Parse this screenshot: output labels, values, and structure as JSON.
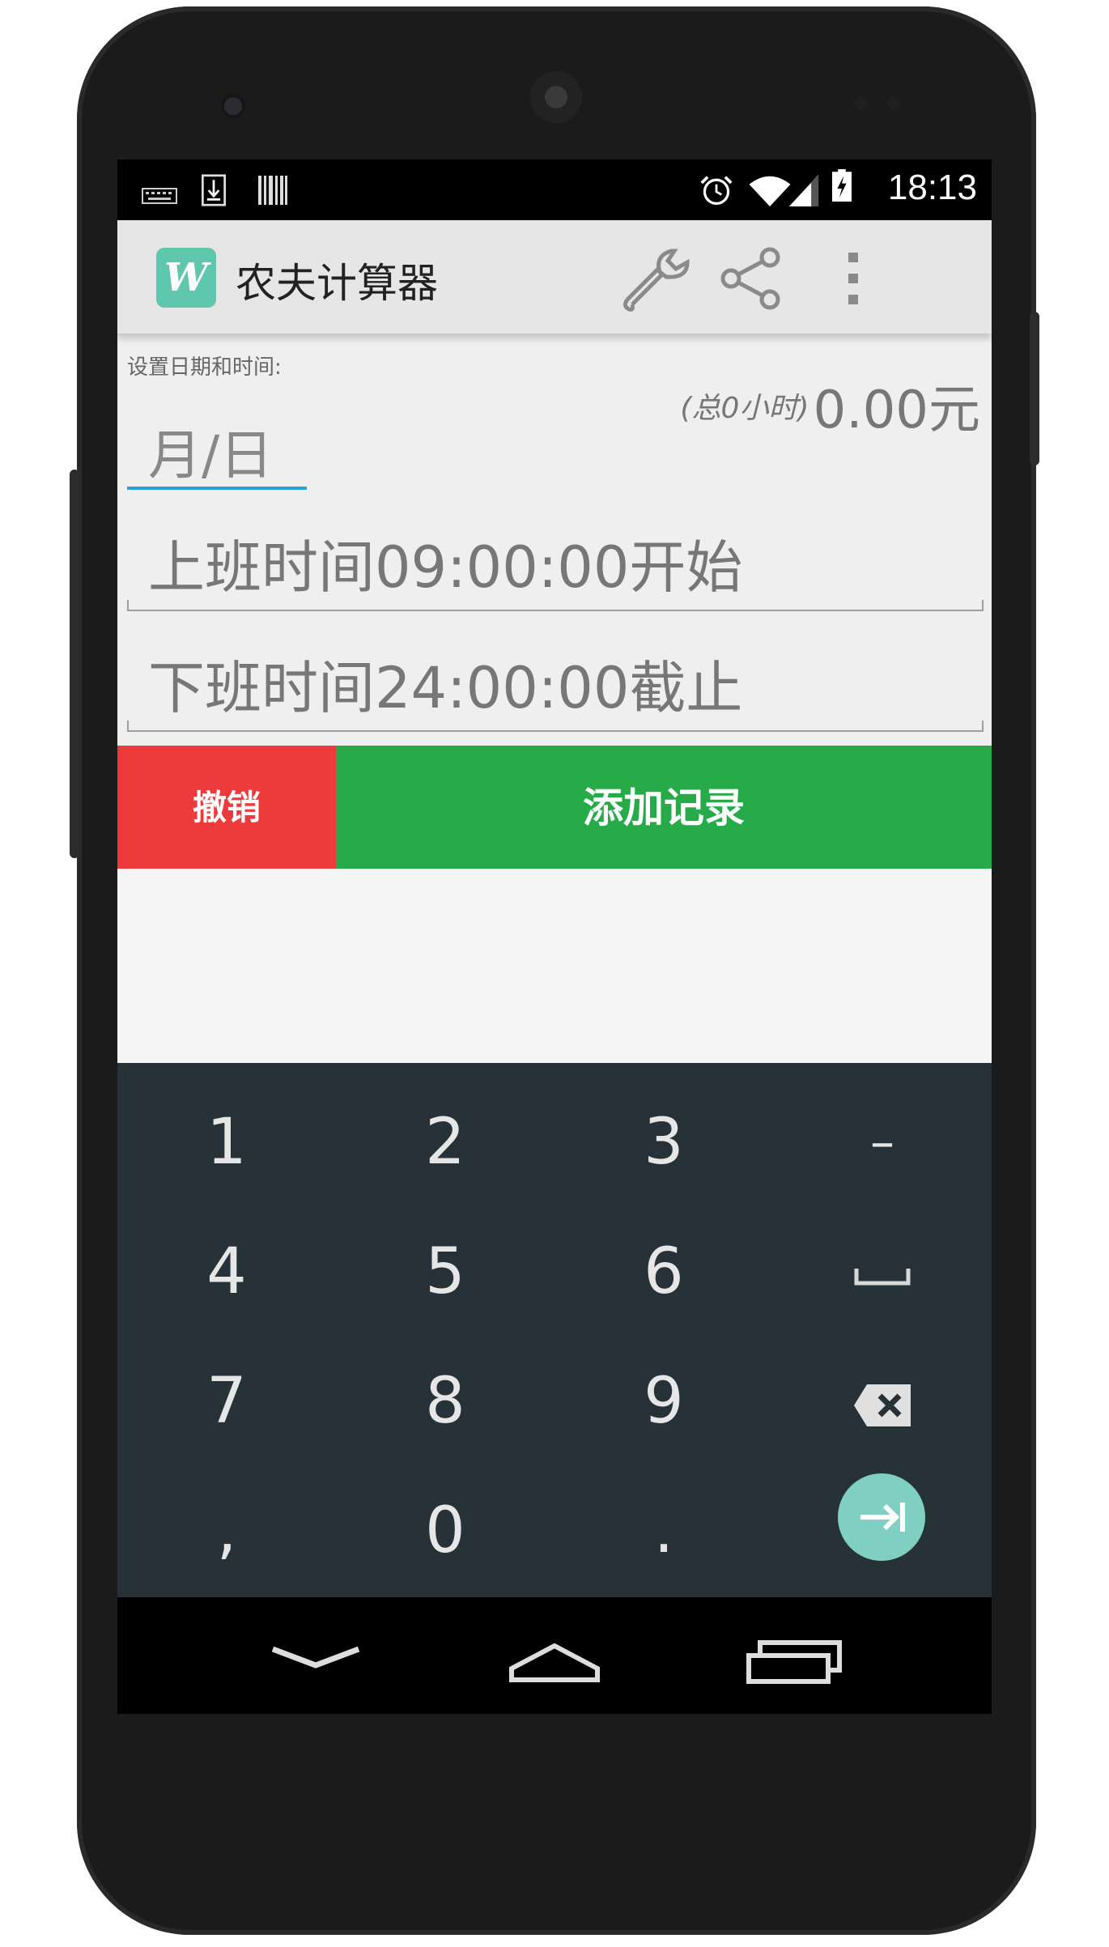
{
  "status_bar": {
    "time": "18:13",
    "left_icons": [
      "keyboard-icon",
      "download-icon",
      "barcode-icon"
    ],
    "right_icons": [
      "alarm-icon",
      "wifi-icon",
      "signal-icon",
      "battery-charging-icon"
    ]
  },
  "action_bar": {
    "app_icon_letter": "W",
    "title": "农夫计算器",
    "actions": [
      "wrench-icon",
      "share-icon",
      "overflow-menu-icon"
    ]
  },
  "form": {
    "date_label": "设置日期和时间:",
    "total_hours": "(总0小时)",
    "total_money": "0.00元",
    "date_placeholder": "月/日",
    "start_placeholder": "上班时间09:00:00开始",
    "end_placeholder": "下班时间24:00:00截止"
  },
  "buttons": {
    "undo": "撤销",
    "add_record": "添加记录"
  },
  "keyboard": {
    "rows": [
      [
        "1",
        "2",
        "3",
        "–"
      ],
      [
        "4",
        "5",
        "6",
        "space-icon"
      ],
      [
        "7",
        "8",
        "9",
        "backspace-icon"
      ],
      [
        ",",
        "0",
        ".",
        "next-icon"
      ]
    ],
    "accent_color": "#7fcfc3"
  },
  "nav_bar": {
    "buttons": [
      "back-icon",
      "home-icon",
      "recents-icon"
    ]
  },
  "colors": {
    "undo_button": "#ed3b3d",
    "add_button": "#26ab48",
    "focus_underline": "#29a1d8",
    "app_icon": "#5fc7ad",
    "keyboard_bg": "#263238"
  }
}
